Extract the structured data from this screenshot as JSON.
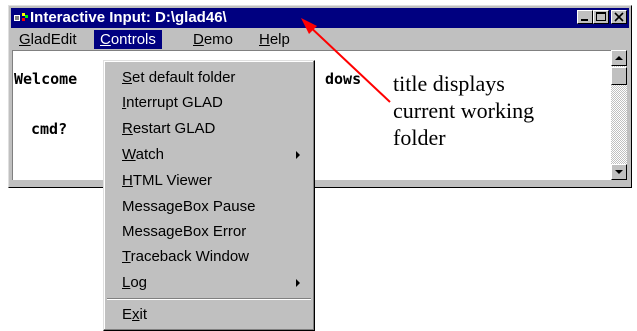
{
  "window": {
    "title": "Interactive Input: D:\\glad46\\",
    "caption_buttons": [
      "minimize-icon",
      "maximize-icon",
      "close-icon"
    ]
  },
  "menubar": {
    "items": [
      {
        "label": "GladEdit"
      },
      {
        "label": "Controls"
      },
      {
        "label": "Demo"
      },
      {
        "label": "Help"
      }
    ],
    "active_item": "Controls"
  },
  "console": {
    "line1_start": "Welcome",
    "line1_end": "dows",
    "prompt": "cmd?"
  },
  "dropdown": {
    "items": [
      {
        "pre": "",
        "mnemonic": "S",
        "post": "et default folder",
        "submenu": false
      },
      {
        "pre": "",
        "mnemonic": "I",
        "post": "nterrupt GLAD",
        "submenu": false
      },
      {
        "pre": "",
        "mnemonic": "R",
        "post": "estart GLAD",
        "submenu": false
      },
      {
        "pre": "",
        "mnemonic": "W",
        "post": "atch",
        "submenu": true
      },
      {
        "pre": "",
        "mnemonic": "H",
        "post": "TML Viewer",
        "submenu": false
      },
      {
        "pre": "MessageBox Pause",
        "mnemonic": "",
        "post": "",
        "submenu": false
      },
      {
        "pre": "MessageBox Error",
        "mnemonic": "",
        "post": "",
        "submenu": false
      },
      {
        "pre": "",
        "mnemonic": "T",
        "post": "raceback Window",
        "submenu": false
      },
      {
        "pre": "",
        "mnemonic": "L",
        "post": "og",
        "submenu": true
      },
      {
        "pre": "E",
        "mnemonic": "x",
        "post": "it",
        "submenu": false
      }
    ]
  },
  "annotation": {
    "lines": [
      "title displays",
      "current working",
      "folder"
    ],
    "arrow_color": "#ff0000"
  },
  "colors": {
    "title_bar": "#000080",
    "window_face": "#c0c0c0",
    "highlight": "#000080"
  }
}
